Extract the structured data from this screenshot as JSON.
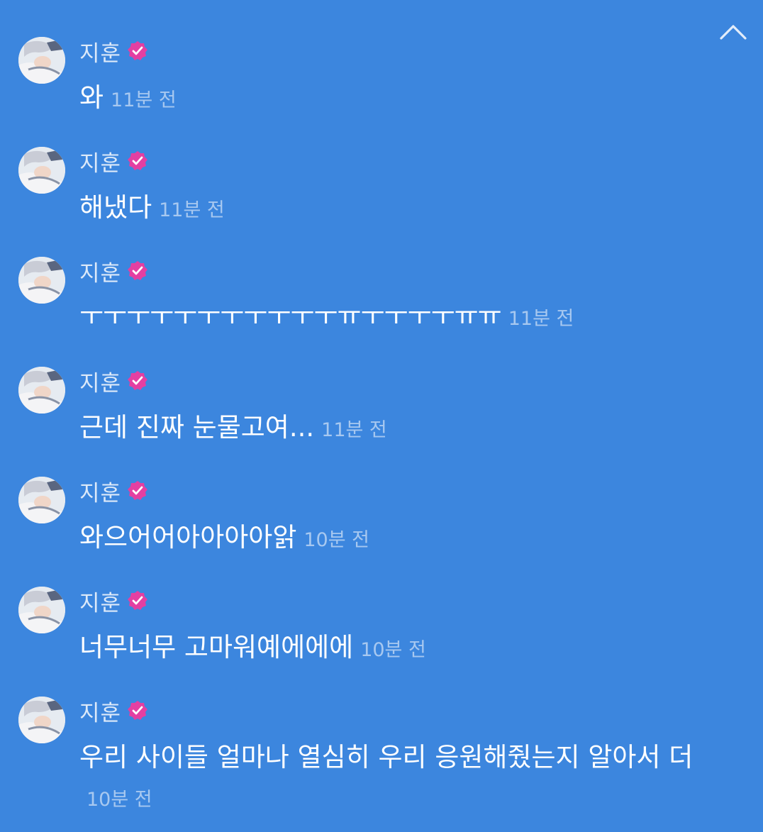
{
  "header": {
    "collapse_icon": "chevron-up-icon"
  },
  "colors": {
    "background": "#3c86de",
    "verified_badge": "#e43fa2",
    "timestamp": "rgba(255,255,255,0.55)"
  },
  "messages": [
    {
      "author": "지훈",
      "text": "와",
      "time": "11분 전",
      "verified": true
    },
    {
      "author": "지훈",
      "text": "해냈다",
      "time": "11분 전",
      "verified": true
    },
    {
      "author": "지훈",
      "text": "ㅜㅜㅜㅜㅜㅜㅜㅜㅜㅜㅜㅠㅜㅜㅜㅜㅠㅠ",
      "time": "11분 전",
      "verified": true
    },
    {
      "author": "지훈",
      "text": "근데 진짜 눈물고여...",
      "time": "11분 전",
      "verified": true
    },
    {
      "author": "지훈",
      "text": "와으어어아아아아앍",
      "time": "10분 전",
      "verified": true
    },
    {
      "author": "지훈",
      "text": "너무너무 고마워예에에에",
      "time": "10분 전",
      "verified": true
    },
    {
      "author": "지훈",
      "text": "우리 사이들 얼마나 열심히 우리 응원해줬는지 알아서 더",
      "time": "10분 전",
      "verified": true
    }
  ]
}
